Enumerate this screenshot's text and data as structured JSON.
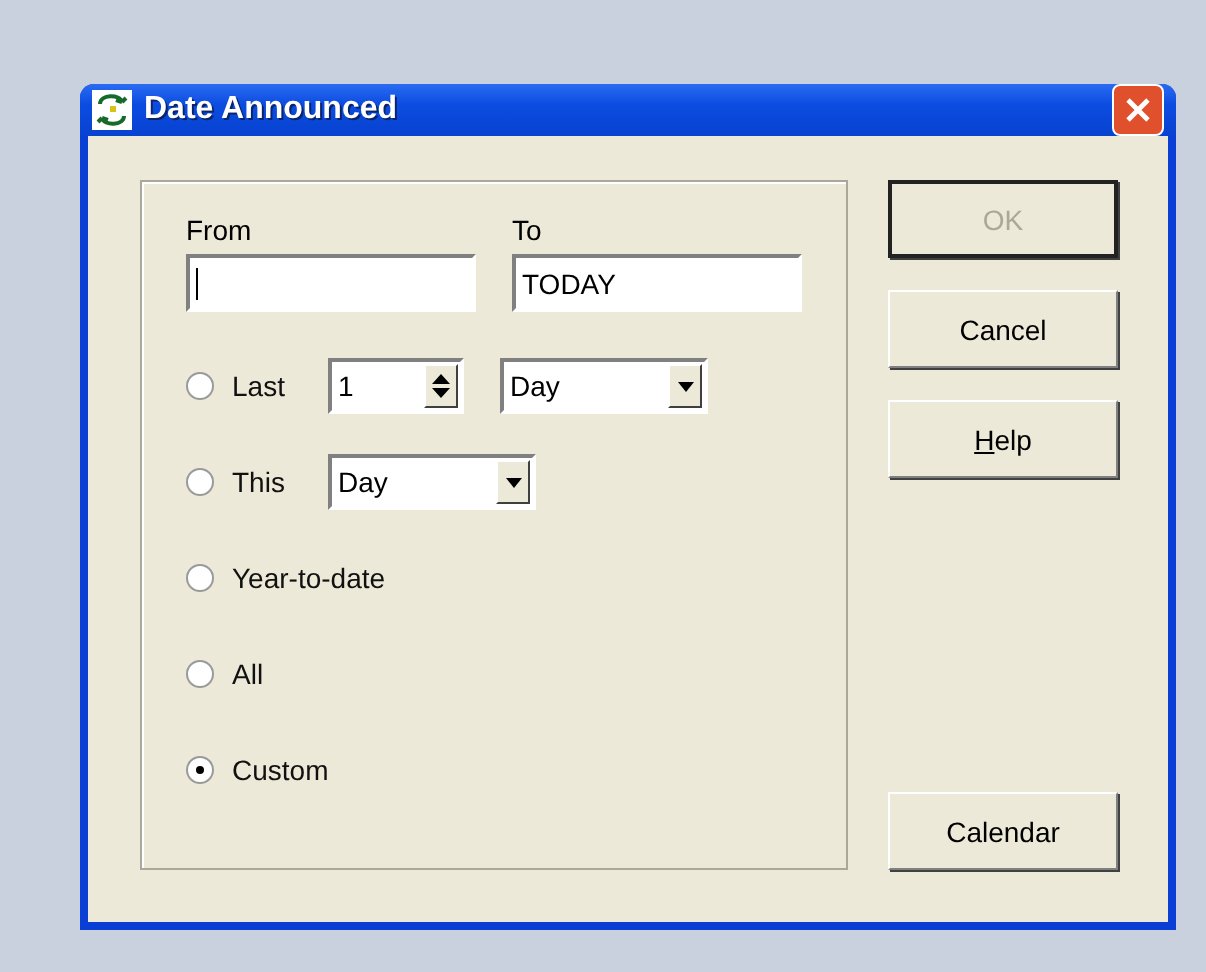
{
  "window": {
    "title": "Date Announced"
  },
  "range": {
    "from": {
      "label": "From",
      "focused": true
    },
    "to": {
      "label": "To",
      "value": "TODAY"
    }
  },
  "options": [
    {
      "kind": "spin_combo",
      "label": "Last",
      "selected": false,
      "count": "1",
      "unit": "Day"
    },
    {
      "kind": "combo",
      "label": "This",
      "selected": false,
      "unit": "Day"
    },
    {
      "kind": "plain",
      "label": "Year-to-date",
      "selected": false
    },
    {
      "kind": "plain",
      "label": "All",
      "selected": false
    },
    {
      "kind": "plain",
      "label": "Custom",
      "selected": true
    }
  ],
  "buttons": [
    {
      "label": "OK",
      "disabled": true,
      "default": true,
      "underline_first": false
    },
    {
      "label": "Cancel",
      "disabled": false,
      "default": false,
      "underline_first": false
    },
    {
      "label": "Help",
      "disabled": false,
      "default": false,
      "underline_first": true
    }
  ],
  "bottom_buttons": [
    {
      "label": "Calendar",
      "disabled": false,
      "default": false,
      "underline_first": false
    }
  ]
}
